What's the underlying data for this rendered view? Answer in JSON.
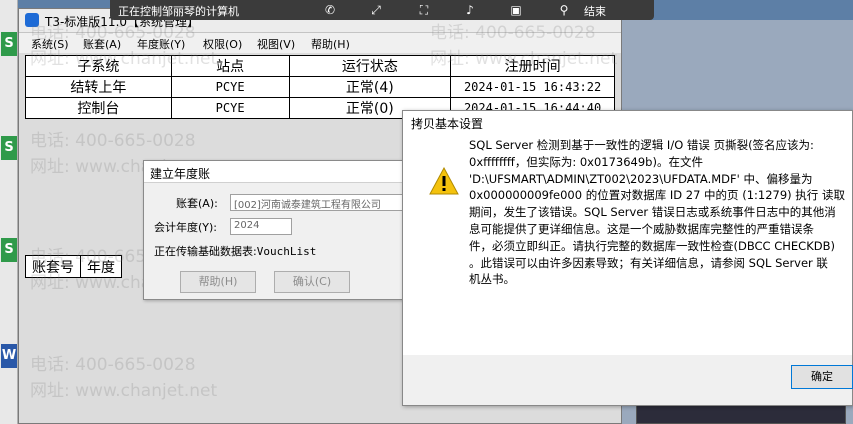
{
  "remote_bar": {
    "status": "正在控制邹丽琴的计算机",
    "end_label": "结束"
  },
  "app": {
    "title": "T3-标准版11.0【系统管理】",
    "menu": [
      "系统(S)",
      "账套(A)",
      "年度账(Y)",
      "权限(O)",
      "视图(V)",
      "帮助(H)"
    ],
    "status_table": {
      "headers": [
        "子系统",
        "站点",
        "运行状态",
        "注册时间"
      ],
      "rows": [
        [
          "结转上年",
          "PCYE",
          "正常(4)",
          "2024-01-15 16:43:22"
        ],
        [
          "控制台",
          "PCYE",
          "正常(0)",
          "2024-01-15 16:44:40"
        ]
      ]
    },
    "account_table": {
      "headers": [
        "账套号",
        "年度"
      ]
    }
  },
  "year_dialog": {
    "title": "建立年度账",
    "account_label": "账套(A):",
    "account_value": "[002]河南诚泰建筑工程有限公司",
    "year_label": "会计年度(Y):",
    "year_value": "2024",
    "status_prefix": "正在传输基础数据表:",
    "status_table": "VouchList",
    "help_button": "帮助(H)",
    "confirm_button": "确认(C)"
  },
  "error_dialog": {
    "title": "拷贝基本设置",
    "message_lines": [
      "SQL Server 检测到基于一致性的逻辑 I/O 错误 页撕裂(签名应该为:",
      "0xffffffff，但实际为: 0x0173649b)。在文件",
      "'D:\\UFSMART\\ADMIN\\ZT002\\2023\\UFDATA.MDF' 中、偏移量为",
      "0x000000009fe000 的位置对数据库 ID 27 中的页 (1:1279) 执行 读取",
      "期间，发生了该错误。SQL Server 错误日志或系统事件日志中的其他消",
      "息可能提供了更详细信息。这是一个威胁数据库完整性的严重错误条",
      "件，必须立即纠正。请执行完整的数据库一致性检查(DBCC CHECKDB)",
      "。此错误可以由许多因素导致；有关详细信息，请参阅 SQL Server 联",
      "机丛书。"
    ],
    "ok_button": "确定"
  },
  "watermark": {
    "phone": "电话: 400-665-0028",
    "site": "网址: www.chanjet.net"
  },
  "colors": {
    "desktop": "#5d7fa6",
    "ok_border": "#0078d7",
    "warning": "#f4c20d"
  }
}
